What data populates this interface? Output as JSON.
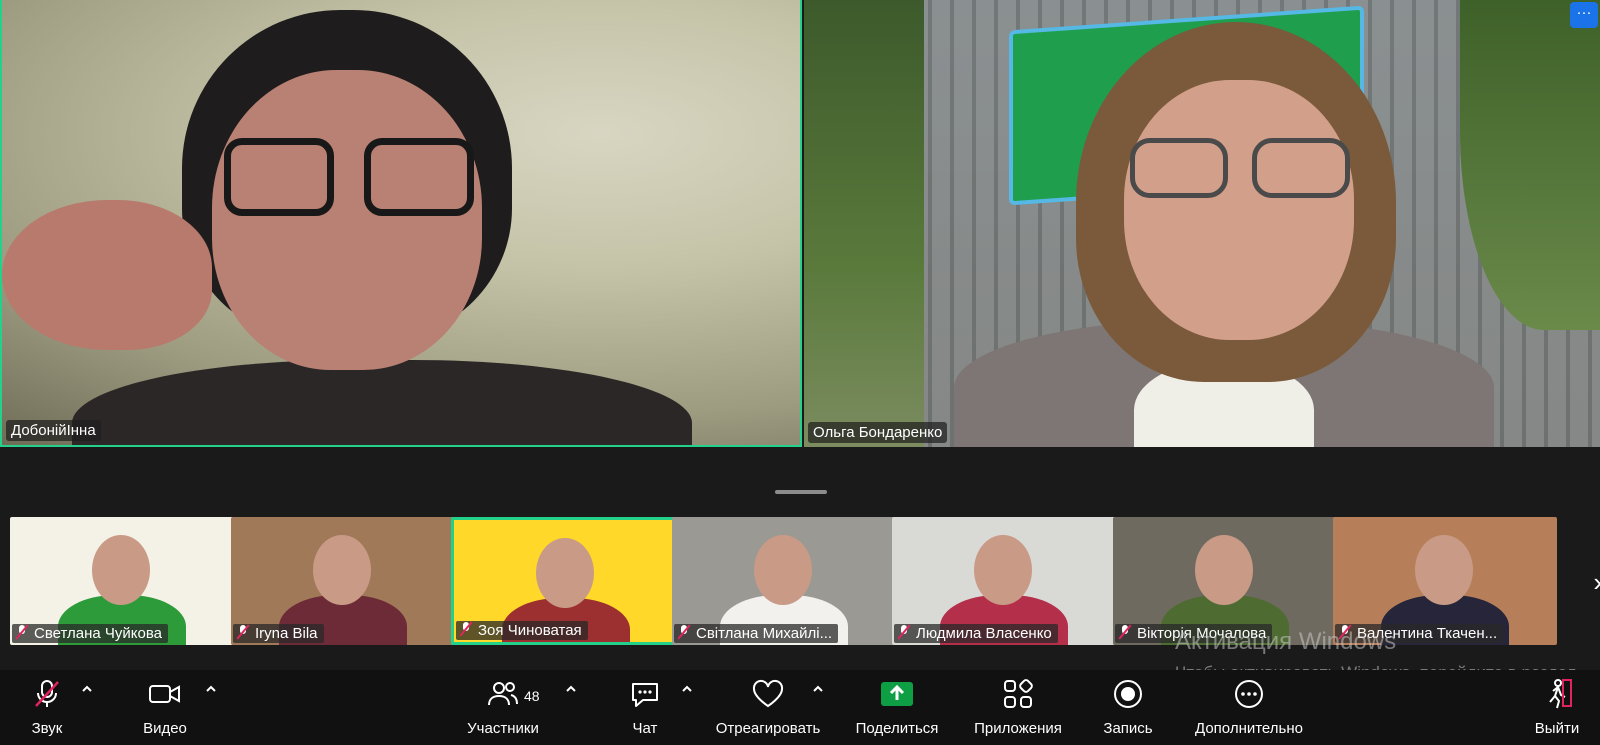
{
  "main_stage": {
    "left_tile": {
      "name": "ДобонійІнна"
    },
    "right_tile": {
      "name": "Ольга Бондаренко",
      "more_badge": "···"
    }
  },
  "thumbnails": [
    {
      "name": "Светлана Чуйкова",
      "muted": true,
      "active": false,
      "bg": "#f4f1e6",
      "accent": "#2e9b3b"
    },
    {
      "name": "Iryna Bila",
      "muted": true,
      "active": false,
      "bg": "#a07a58",
      "accent": "#6d2b38"
    },
    {
      "name": "Зоя Чиноватая",
      "muted": true,
      "active": true,
      "bg": "#ffd829",
      "accent": "#9c2f2f"
    },
    {
      "name": "Світлана Михайлі...",
      "muted": true,
      "active": false,
      "bg": "#9a9994",
      "accent": "#f3f1ee"
    },
    {
      "name": "Людмила Власенко",
      "muted": true,
      "active": false,
      "bg": "#d9d9d5",
      "accent": "#b32f4a"
    },
    {
      "name": "Вікторія Мочалова",
      "muted": true,
      "active": false,
      "bg": "#6f6a60",
      "accent": "#4e6b31"
    },
    {
      "name": "Валентина Ткачен...",
      "muted": true,
      "active": false,
      "bg": "#b67f5a",
      "accent": "#26253a"
    }
  ],
  "watermark": {
    "title": "Активация Windows",
    "text": "Чтобы активировать Windows, перейдите в раздел \"Параметры\"."
  },
  "toolbar": {
    "audio": "Звук",
    "video": "Видео",
    "participants": "Участники",
    "participants_count": "48",
    "chat": "Чат",
    "react": "Отреагировать",
    "share": "Поделиться",
    "apps": "Приложения",
    "record": "Запись",
    "more": "Дополнительно",
    "leave": "Выйти"
  },
  "colors": {
    "active_border": "#23d18b",
    "share_green": "#0e9f45",
    "leave_red": "#e0245e"
  }
}
